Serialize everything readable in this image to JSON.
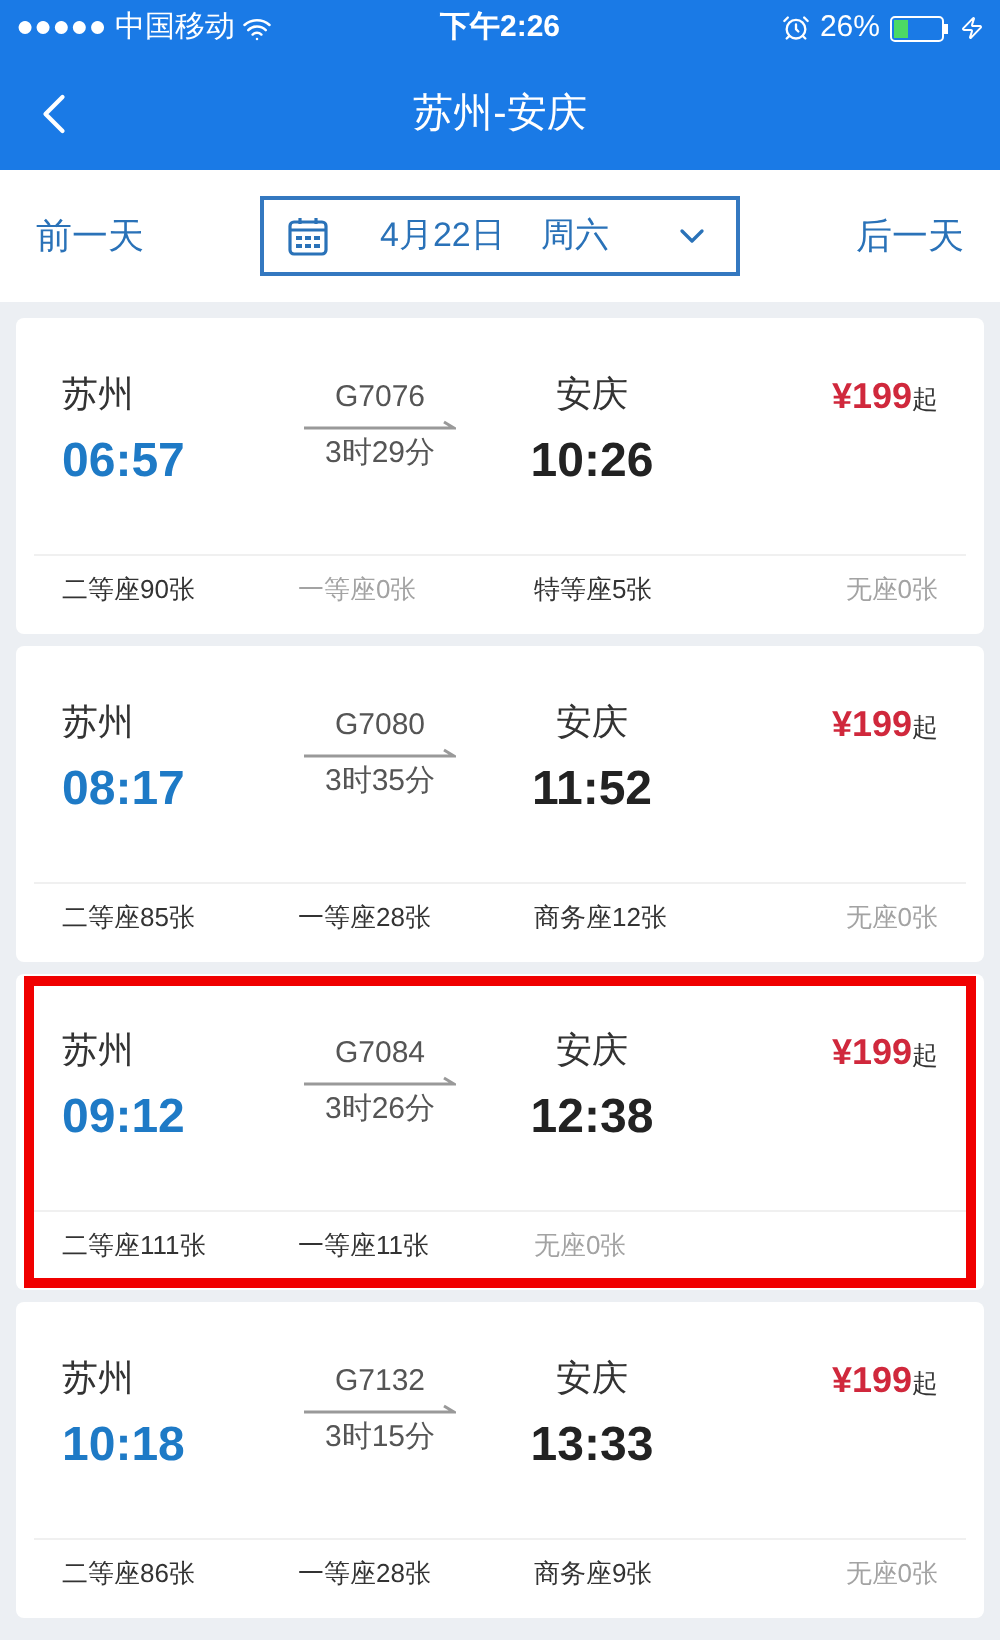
{
  "status_bar": {
    "carrier": "●●●●● 中国移动",
    "time": "下午2:26",
    "battery": "26%"
  },
  "nav": {
    "title": "苏州-安庆"
  },
  "date_bar": {
    "prev": "前一天",
    "date": "4月22日",
    "weekday": "周六",
    "next": "后一天"
  },
  "trains": [
    {
      "from": "苏州",
      "depart": "06:57",
      "number": "G7076",
      "duration": "3时29分",
      "to": "安庆",
      "arrive": "10:26",
      "price": "¥199",
      "price_suffix": "起",
      "highlighted": false,
      "seats": [
        {
          "label": "二等座90张",
          "available": true
        },
        {
          "label": "一等座0张",
          "available": false
        },
        {
          "label": "特等座5张",
          "available": true
        },
        {
          "label": "无座0张",
          "available": false
        }
      ]
    },
    {
      "from": "苏州",
      "depart": "08:17",
      "number": "G7080",
      "duration": "3时35分",
      "to": "安庆",
      "arrive": "11:52",
      "price": "¥199",
      "price_suffix": "起",
      "highlighted": false,
      "seats": [
        {
          "label": "二等座85张",
          "available": true
        },
        {
          "label": "一等座28张",
          "available": true
        },
        {
          "label": "商务座12张",
          "available": true
        },
        {
          "label": "无座0张",
          "available": false
        }
      ]
    },
    {
      "from": "苏州",
      "depart": "09:12",
      "number": "G7084",
      "duration": "3时26分",
      "to": "安庆",
      "arrive": "12:38",
      "price": "¥199",
      "price_suffix": "起",
      "highlighted": true,
      "seats": [
        {
          "label": "二等座111张",
          "available": true
        },
        {
          "label": "一等座11张",
          "available": true
        },
        {
          "label": "无座0张",
          "available": false
        }
      ]
    },
    {
      "from": "苏州",
      "depart": "10:18",
      "number": "G7132",
      "duration": "3时15分",
      "to": "安庆",
      "arrive": "13:33",
      "price": "¥199",
      "price_suffix": "起",
      "highlighted": false,
      "seats": [
        {
          "label": "二等座86张",
          "available": true
        },
        {
          "label": "一等座28张",
          "available": true
        },
        {
          "label": "商务座9张",
          "available": true
        },
        {
          "label": "无座0张",
          "available": false
        }
      ]
    }
  ]
}
